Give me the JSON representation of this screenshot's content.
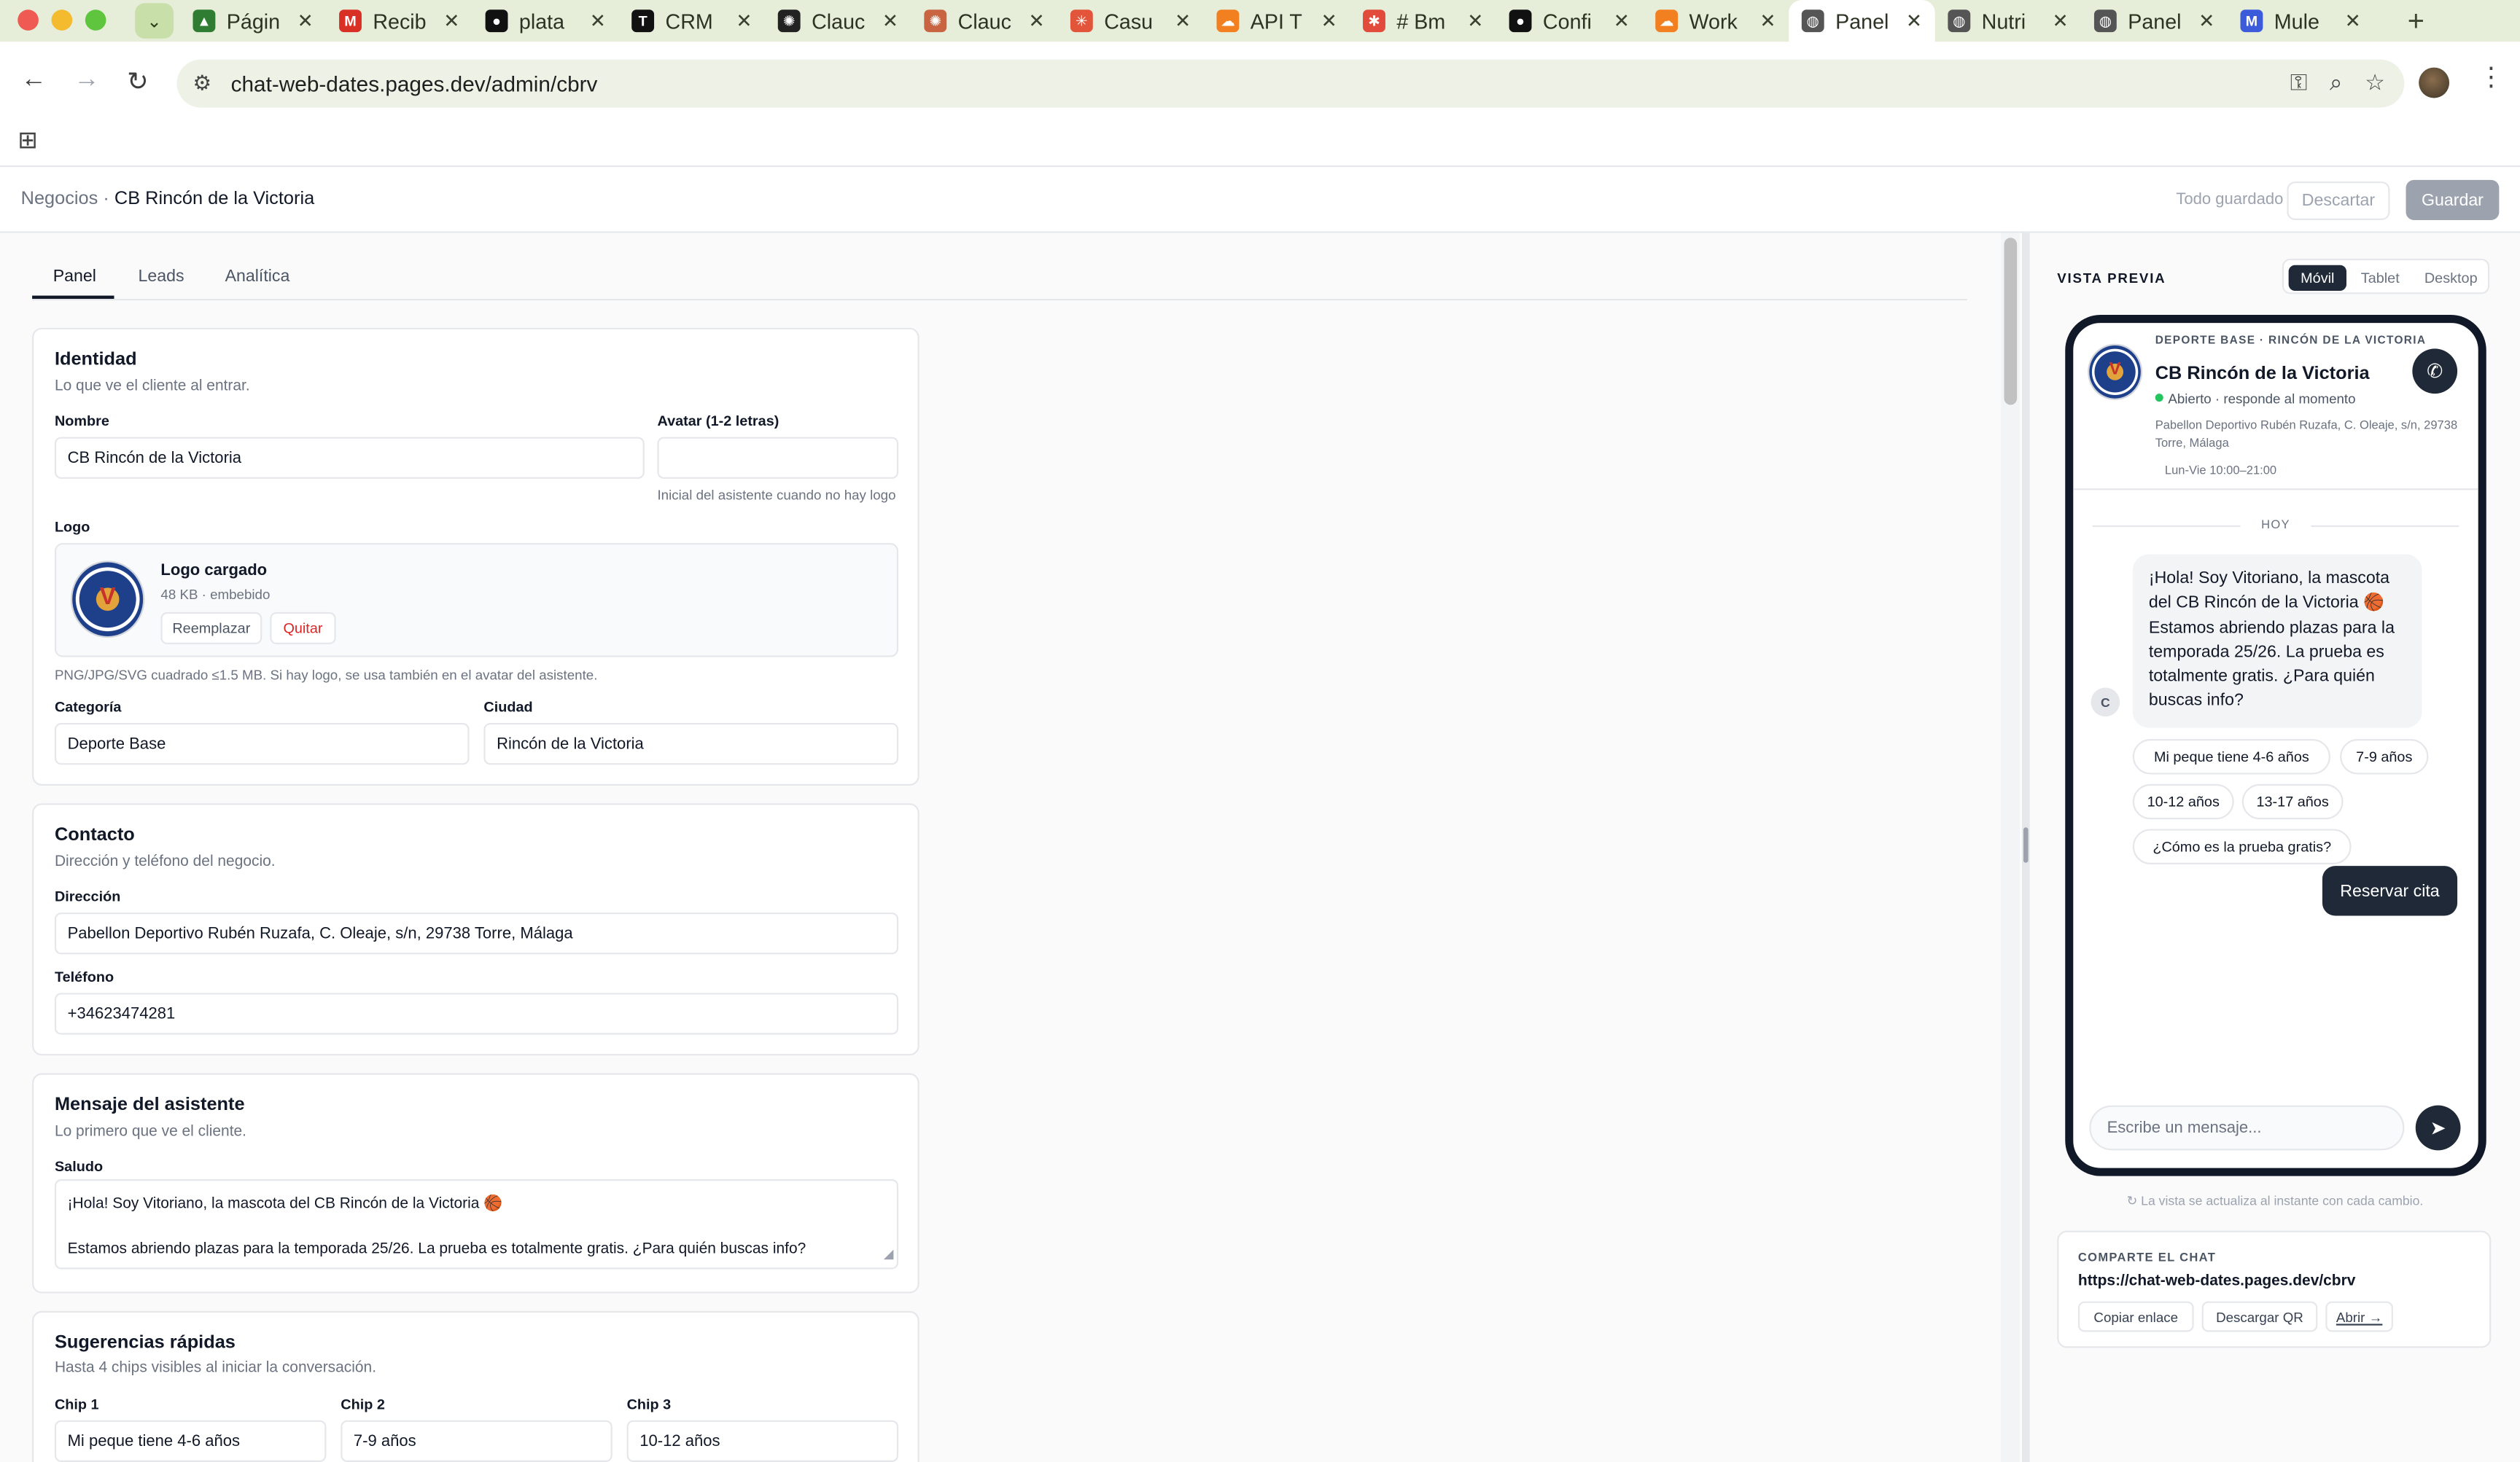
{
  "browser": {
    "tabs": [
      {
        "label": "Págin",
        "fav_color": "#2e7d32",
        "fav_glyph": "▲"
      },
      {
        "label": "Recib",
        "fav_color": "#d93025",
        "fav_glyph": "M"
      },
      {
        "label": "plata",
        "fav_color": "#111111",
        "fav_glyph": "●"
      },
      {
        "label": "CRM",
        "fav_color": "#111111",
        "fav_glyph": "T"
      },
      {
        "label": "Clauc",
        "fav_color": "#222222",
        "fav_glyph": "✺"
      },
      {
        "label": "Clauc",
        "fav_color": "#c96442",
        "fav_glyph": "✺"
      },
      {
        "label": "Casu",
        "fav_color": "#e2553b",
        "fav_glyph": "✳"
      },
      {
        "label": "API T",
        "fav_color": "#f38020",
        "fav_glyph": "☁"
      },
      {
        "label": "# Bm",
        "fav_color": "#e24a3b",
        "fav_glyph": "✱"
      },
      {
        "label": "Confi",
        "fav_color": "#111111",
        "fav_glyph": "●"
      },
      {
        "label": "Work",
        "fav_color": "#f38020",
        "fav_glyph": "☁"
      },
      {
        "label": "Panel",
        "fav_color": "#555555",
        "fav_glyph": "◍"
      },
      {
        "label": "Nutri",
        "fav_color": "#555555",
        "fav_glyph": "◍"
      },
      {
        "label": "Panel",
        "fav_color": "#555555",
        "fav_glyph": "◍"
      },
      {
        "label": "Mule",
        "fav_color": "#3b5bdb",
        "fav_glyph": "M"
      }
    ],
    "active_tab_index": 11,
    "url": "chat-web-dates.pages.dev/admin/cbrv"
  },
  "header": {
    "breadcrumb_parent": "Negocios",
    "breadcrumb_sep": " · ",
    "breadcrumb_current": "CB Rincón de la Victoria",
    "status": "Todo guardado",
    "discard_label": "Descartar",
    "save_label": "Guardar"
  },
  "page_tabs": [
    "Panel",
    "Leads",
    "Analítica"
  ],
  "identity": {
    "title": "Identidad",
    "subtitle": "Lo que ve el cliente al entrar.",
    "name_label": "Nombre",
    "name_value": "CB Rincón de la Victoria",
    "avatar_label": "Avatar (1-2 letras)",
    "avatar_value": "",
    "avatar_hint": "Inicial del asistente cuando no hay logo",
    "logo_label": "Logo",
    "logo_status": "Logo cargado",
    "logo_meta": "48 KB · embebido",
    "logo_replace": "Reemplazar",
    "logo_remove": "Quitar",
    "logo_hint": "PNG/JPG/SVG cuadrado ≤1.5 MB. Si hay logo, se usa también en el avatar del asistente.",
    "category_label": "Categoría",
    "category_value": "Deporte Base",
    "city_label": "Ciudad",
    "city_value": "Rincón de la Victoria"
  },
  "contact": {
    "title": "Contacto",
    "subtitle": "Dirección y teléfono del negocio.",
    "address_label": "Dirección",
    "address_value": "Pabellon Deportivo Rubén Ruzafa, C. Oleaje, s/n, 29738 Torre, Málaga",
    "phone_label": "Teléfono",
    "phone_value": "+34623474281"
  },
  "assistant": {
    "title": "Mensaje del asistente",
    "subtitle": "Lo primero que ve el cliente.",
    "greeting_label": "Saludo",
    "greeting_line1": "¡Hola! Soy Vitoriano, la mascota del CB Rincón de la Victoria 🏀",
    "greeting_line2": "Estamos abriendo plazas para la temporada 25/26. La prueba es totalmente gratis. ¿Para quién buscas info?"
  },
  "suggestions": {
    "title": "Sugerencias rápidas",
    "subtitle": "Hasta 4 chips visibles al iniciar la conversación.",
    "chip1_label": "Chip 1",
    "chip1_value": "Mi peque tiene 4-6 años",
    "chip2_label": "Chip 2",
    "chip2_value": "7-9 años",
    "chip3_label": "Chip 3",
    "chip3_value": "10-12 años"
  },
  "preview": {
    "title": "VISTA PREVIA",
    "modes": [
      "Móvil",
      "Tablet",
      "Desktop"
    ],
    "active_mode": "Móvil",
    "phone": {
      "kicker": "DEPORTE BASE · RINCÓN DE LA VICTORIA",
      "name": "CB Rincón de la Victoria",
      "status": "Abierto · responde al momento",
      "address": "Pabellon Deportivo Rubén Ruzafa, C. Oleaje, s/n, 29738 Torre, Málaga",
      "hours": "Lun-Vie 10:00–21:00",
      "day_separator": "HOY",
      "bot_avatar": "C",
      "bot_message": "¡Hola! Soy Vitoriano, la mascota del CB Rincón de la Victoria 🏀 Estamos abriendo plazas para la temporada 25/26. La prueba es totalmente gratis. ¿Para quién buscas info?",
      "chips": [
        "Mi peque tiene 4-6 años",
        "7-9 años",
        "10-12 años",
        "13-17 años",
        "¿Cómo es la prueba gratis?"
      ],
      "user_message": "Reservar cita",
      "input_placeholder": "Escribe un mensaje..."
    },
    "live_note": "↻ La vista se actualiza al instante con cada cambio.",
    "share": {
      "title": "COMPARTE EL CHAT",
      "url": "https://chat-web-dates.pages.dev/cbrv",
      "copy_label": "Copiar enlace",
      "qr_label": "Descargar QR",
      "open_label": "Abrir →"
    }
  },
  "colors": {
    "accent_dark": "#1f2937",
    "online_dot": "#22c55e",
    "danger_text": "#dc2626"
  }
}
